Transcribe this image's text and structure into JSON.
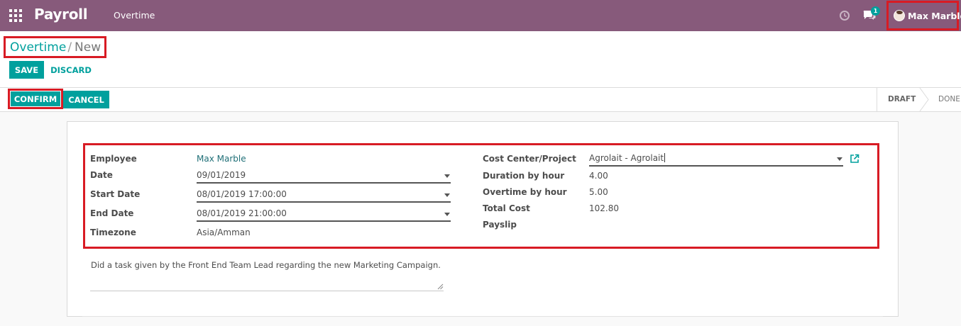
{
  "navbar": {
    "app_name": "Payroll",
    "menu_item": "Overtime",
    "notification_count": "1",
    "user_name": "Max Marble",
    "brand_color": "#875a7b"
  },
  "breadcrumb": {
    "parent": "Overtime",
    "separator": "/",
    "current": "New"
  },
  "toolbar": {
    "save_label": "SAVE",
    "discard_label": "DISCARD"
  },
  "statusbar": {
    "confirm_label": "CONFIRM",
    "cancel_label": "CANCEL",
    "stages": [
      "DRAFT",
      "DONE"
    ],
    "active_stage": "DRAFT"
  },
  "form": {
    "left": {
      "employee_label": "Employee",
      "employee_value": "Max Marble",
      "date_label": "Date",
      "date_value": "09/01/2019",
      "start_label": "Start Date",
      "start_value": "08/01/2019 17:00:00",
      "end_label": "End Date",
      "end_value": "08/01/2019 21:00:00",
      "tz_label": "Timezone",
      "tz_value": "Asia/Amman"
    },
    "right": {
      "cost_center_label": "Cost Center/Project",
      "cost_center_value": "Agrolait - Agrolait",
      "duration_label": "Duration by hour",
      "duration_value": "4.00",
      "overtime_label": "Overtime by hour",
      "overtime_value": "5.00",
      "total_cost_label": "Total Cost",
      "total_cost_value": "102.80",
      "payslip_label": "Payslip"
    },
    "note": "Did a task given by the Front End Team Lead regarding the new Marketing Campaign."
  },
  "colors": {
    "accent": "#00a09d",
    "highlight": "#d81b24"
  }
}
